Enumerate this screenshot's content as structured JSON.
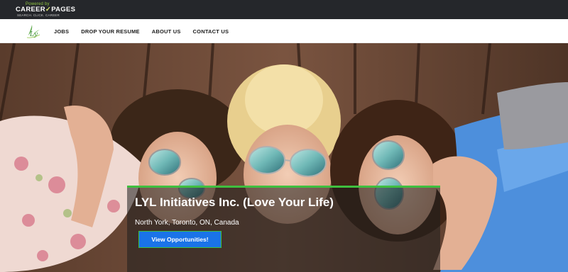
{
  "brand": {
    "top": "Powered by",
    "name_part1": "CAREER",
    "name_part2": "PAGES",
    "tagline": "SEARCH. CLICK. CAREER"
  },
  "nav": {
    "items": [
      "JOBS",
      "DROP YOUR RESUME",
      "ABOUT US",
      "CONTACT US"
    ]
  },
  "hero": {
    "company": "LYL Initiatives Inc. (Love Your Life)",
    "location": "North York, Toronto, ON, Canada",
    "cta_label": "View Opportunities!"
  },
  "colors": {
    "topbar": "#25272b",
    "accent_green": "#3fbf3f",
    "cta_blue": "#1a73e8",
    "brand_green": "#8fc540"
  },
  "icons": {
    "logo": "lyl-leaf-logo"
  }
}
